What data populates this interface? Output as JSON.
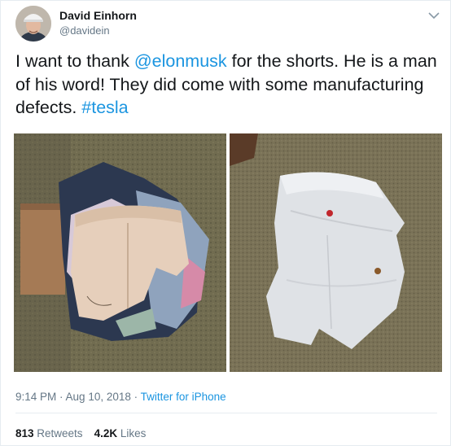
{
  "tweet": {
    "author": {
      "name": "David Einhorn",
      "handle": "@davidein",
      "avatar_icon": "user-avatar-photo"
    },
    "text_parts": {
      "part1": "I want to thank ",
      "mention": "@elonmusk",
      "part2": " for the shorts. He is a man of his word!  They did come with some manufacturing defects. ",
      "hashtag": "#tesla"
    },
    "images": [
      {
        "icon": "photo-shorts-on-clothes-pile"
      },
      {
        "icon": "photo-white-shorts-on-carpet"
      }
    ],
    "meta": {
      "time": "9:14 PM",
      "sep1": " · ",
      "date": "Aug 10, 2018",
      "sep2": " · ",
      "source": "Twitter for iPhone"
    },
    "stats": {
      "retweets_count": "813",
      "retweets_label": " Retweets",
      "likes_count": "4.2K",
      "likes_label": " Likes"
    },
    "menu_icon": "chevron-down-icon",
    "colors": {
      "link": "#1b95e0",
      "text": "#14171a",
      "secondary": "#657786",
      "border": "#e6ecf0"
    }
  }
}
